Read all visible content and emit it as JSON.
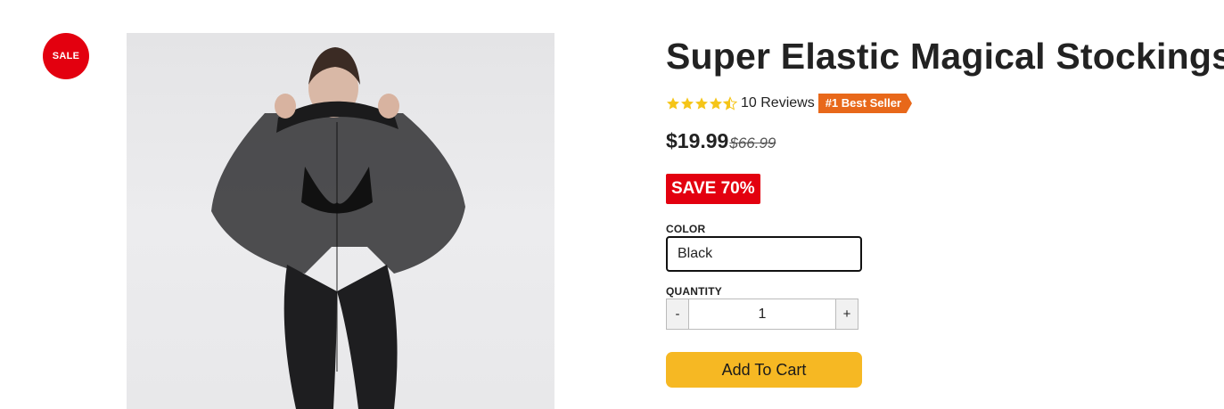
{
  "badge": {
    "label": "SALE"
  },
  "product": {
    "title": "Super Elastic Magical Stockings",
    "rating": 4.5,
    "reviews_label": "10 Reviews",
    "bestseller_label": "#1 Best Seller",
    "price": "$19.99",
    "compare_price": "$66.99",
    "save_label": "SAVE 70%"
  },
  "options": {
    "color_label": "COLOR",
    "color_value": "Black",
    "quantity_label": "QUANTITY",
    "quantity_value": "1",
    "minus_label": "-",
    "plus_label": "+"
  },
  "cart": {
    "add_label": "Add To Cart"
  },
  "colors": {
    "sale_red": "#e3000f",
    "star": "#f5c518",
    "bestseller": "#e8681a",
    "cart_button": "#f6b823"
  },
  "icons": {
    "rating": "star-icon",
    "product_image": "product-photo"
  }
}
